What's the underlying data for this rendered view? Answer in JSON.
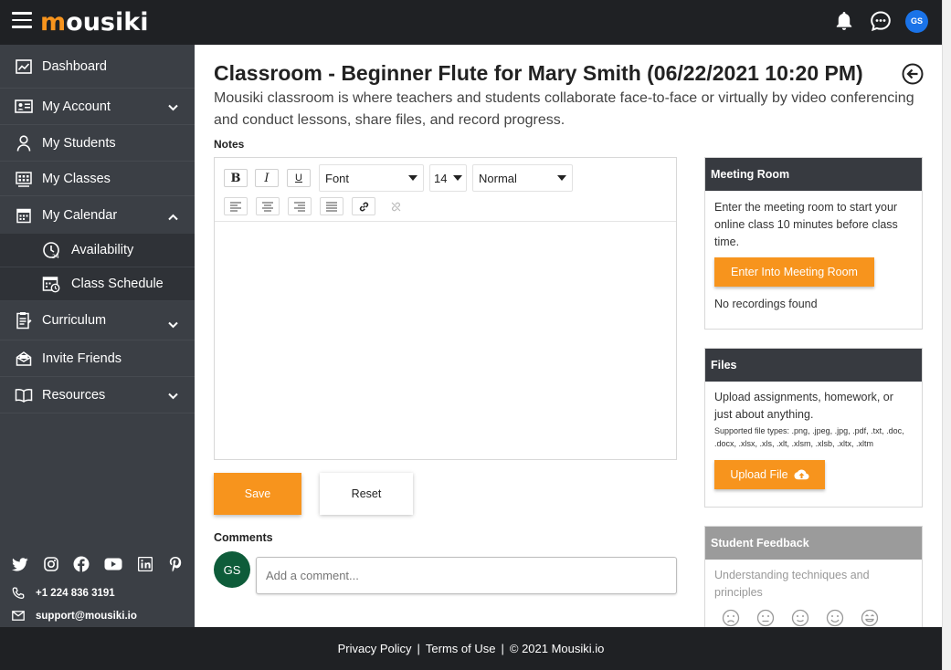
{
  "app": {
    "logo_initial": "m",
    "logo_rest": "ousiki",
    "user_initials": "GS"
  },
  "colors": {
    "accent": "#f7941d",
    "topbar": "#1f2124",
    "sidebar": "#3b3f45",
    "avatar_blue": "#1a73e8",
    "avatar_green": "#0e5c3a"
  },
  "sidebar": {
    "items": [
      {
        "label": "Dashboard",
        "icon": "chart-icon"
      },
      {
        "label": "My Account",
        "icon": "id-card-icon",
        "expandable": true
      },
      {
        "label": "My Students",
        "icon": "person-icon"
      },
      {
        "label": "My Classes",
        "icon": "classes-icon"
      },
      {
        "label": "My Calendar",
        "icon": "calendar-icon",
        "expanded": true
      },
      {
        "label": "Availability",
        "icon": "clock-24-icon",
        "sub": true
      },
      {
        "label": "Class Schedule",
        "icon": "schedule-icon",
        "sub": true
      },
      {
        "label": "Curriculum",
        "icon": "clipboard-icon",
        "expandable": true
      },
      {
        "label": "Invite Friends",
        "icon": "envelope-open-icon"
      },
      {
        "label": "Resources",
        "icon": "book-icon",
        "expandable": true
      }
    ],
    "phone": "+1 224 836 3191",
    "email": "support@mousiki.io"
  },
  "main": {
    "title": "Classroom - Beginner Flute for Mary Smith (06/22/2021 10:20 PM)",
    "subtitle": "Mousiki classroom is where teachers and students collaborate face-to-face or virtually by video conferencing and conduct lessons, share files, and record progress.",
    "notes_label": "Notes",
    "editor": {
      "bold": "B",
      "italic": "I",
      "underline": "U",
      "font": "Font",
      "size": "14",
      "style": "Normal"
    },
    "save_label": "Save",
    "reset_label": "Reset",
    "comments_label": "Comments",
    "comment_placeholder": "Add a comment..."
  },
  "meeting": {
    "header": "Meeting Room",
    "text": "Enter the meeting room to start your online class 10 minutes before class time.",
    "button": "Enter Into Meeting Room",
    "recordings": "No recordings found"
  },
  "files": {
    "header": "Files",
    "text": "Upload assignments, homework, or just about anything.",
    "types": "Supported file types: .png, .jpeg, .jpg, .pdf, .txt, .doc, .docx, .xlsx, .xls, .xlt, .xlsm, .xlsb, .xltx, .xltm",
    "button": "Upload File"
  },
  "feedback": {
    "header": "Student Feedback",
    "text": "Understanding techniques and principles"
  },
  "footer": {
    "privacy": "Privacy Policy",
    "terms": "Terms of Use",
    "copyright": "© 2021 Mousiki.io",
    "sep": "|"
  }
}
